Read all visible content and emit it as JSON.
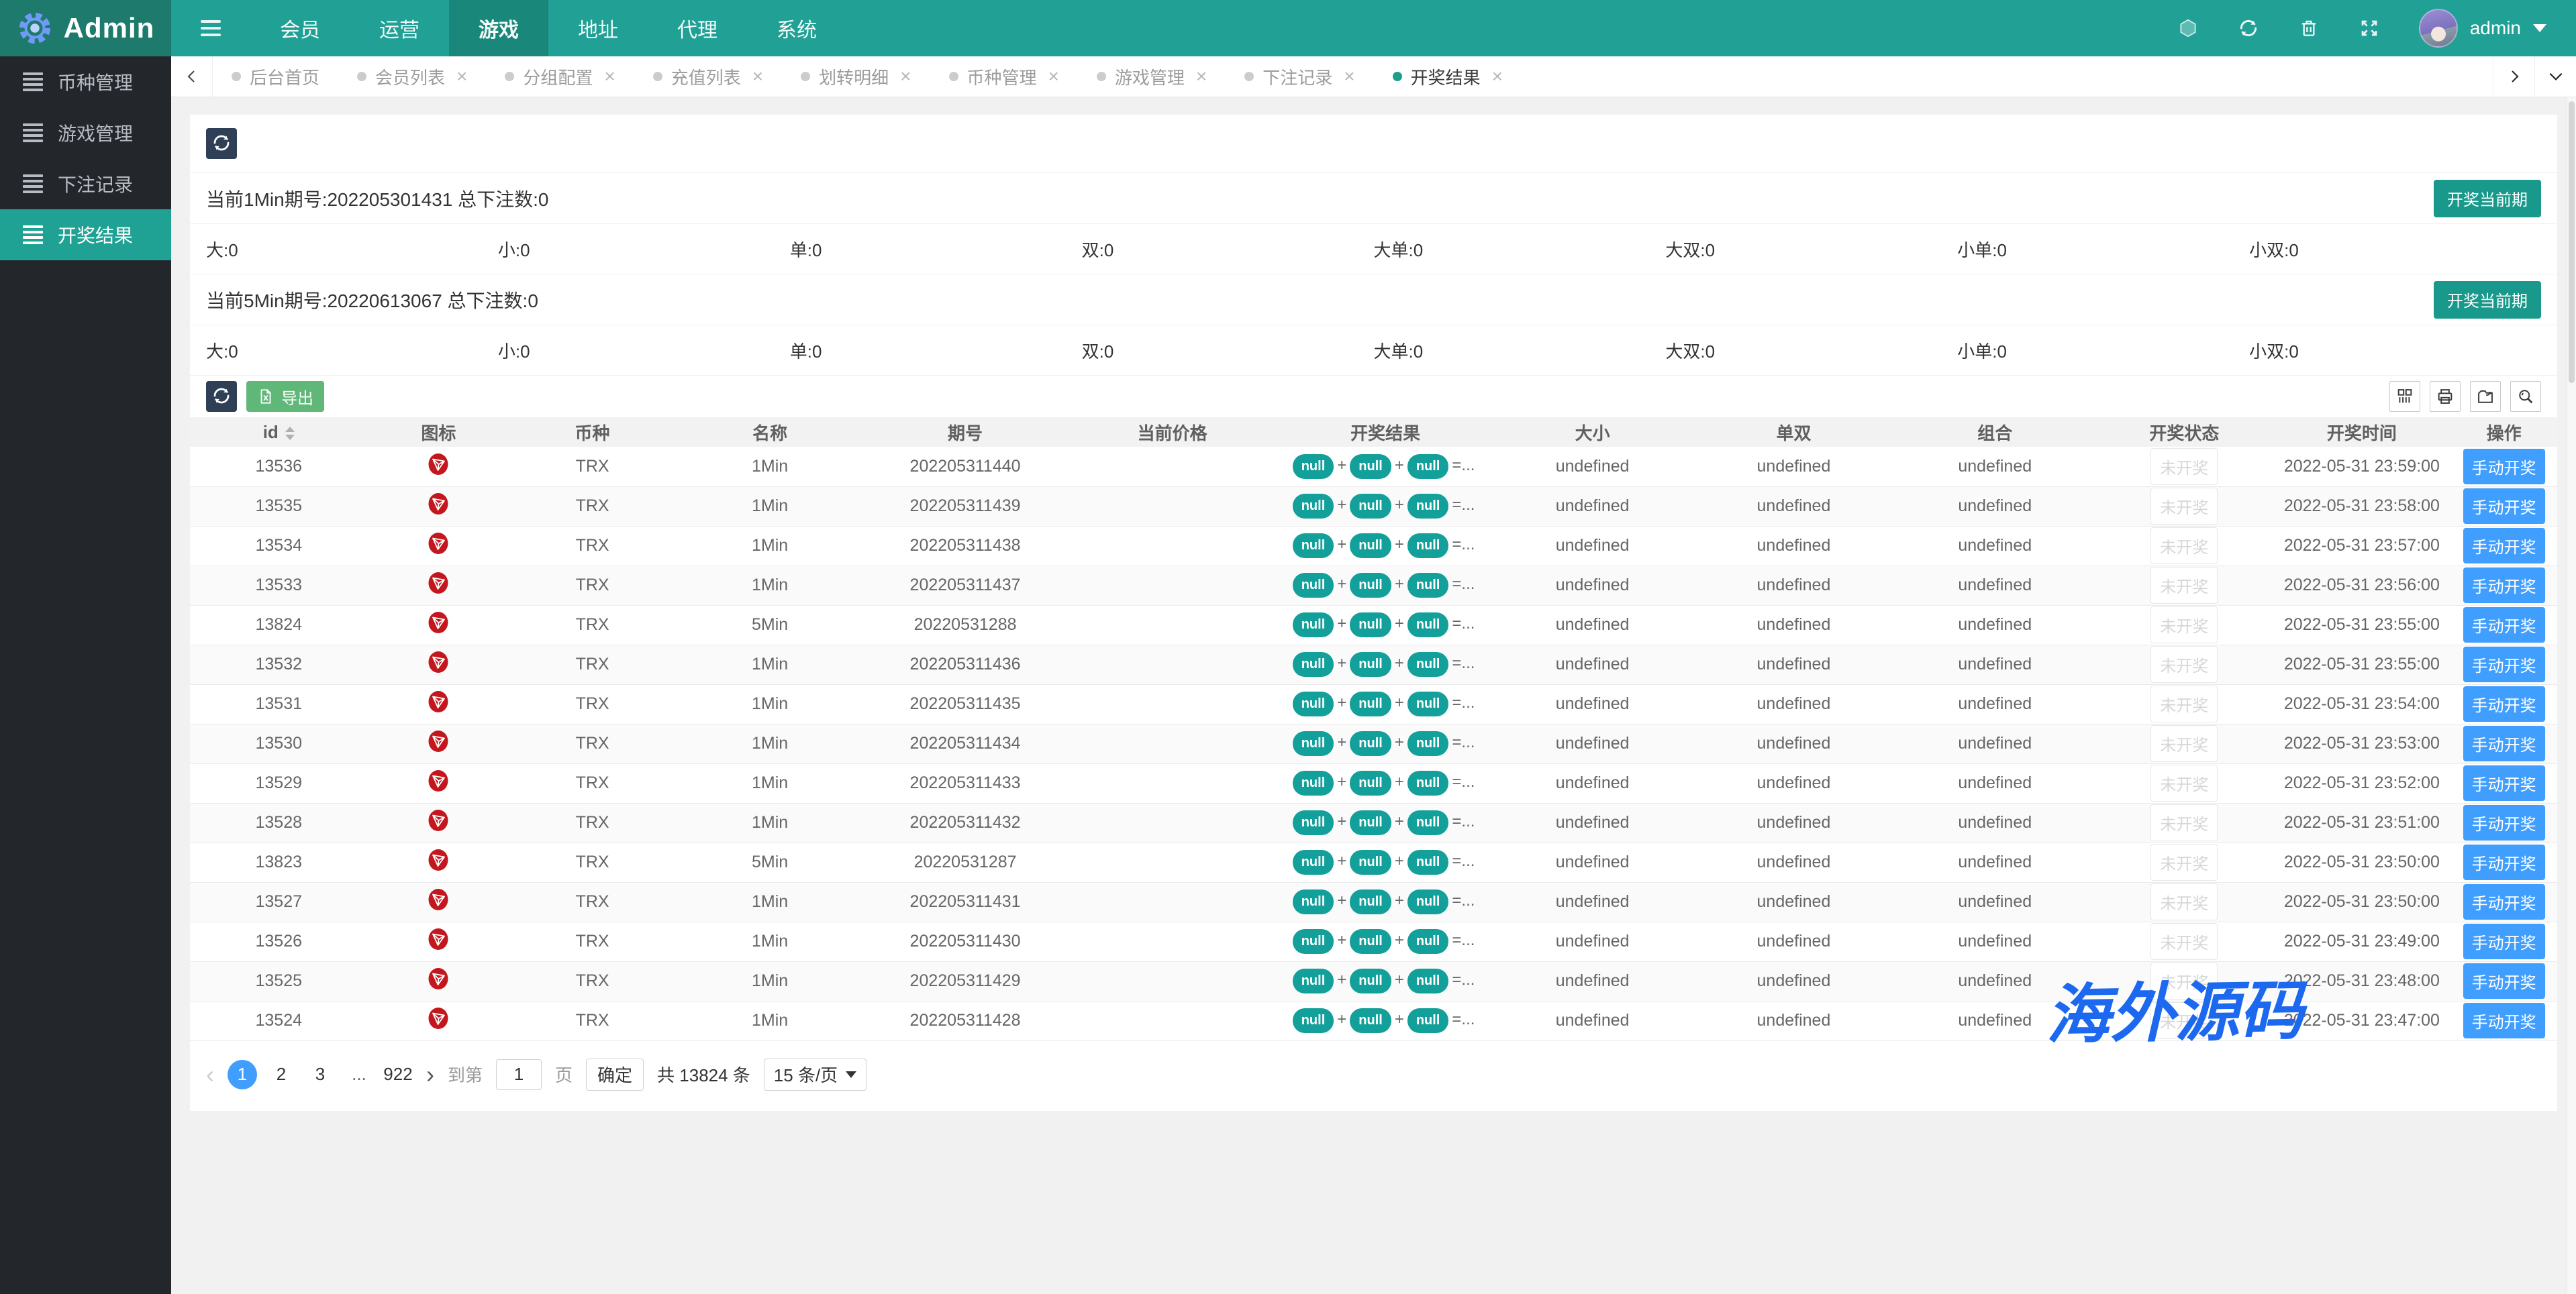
{
  "topbar": {
    "brand": "Admin",
    "nav_items": [
      "会员",
      "运营",
      "游戏",
      "地址",
      "代理",
      "系统"
    ],
    "active_nav": "游戏",
    "user": "admin"
  },
  "sidebar": {
    "items": [
      {
        "label": "币种管理",
        "active": false
      },
      {
        "label": "游戏管理",
        "active": false
      },
      {
        "label": "下注记录",
        "active": false
      },
      {
        "label": "开奖结果",
        "active": true
      }
    ]
  },
  "tabbar": {
    "close_glyph": "×",
    "tabs": [
      {
        "label": "后台首页",
        "closable": false,
        "active": false
      },
      {
        "label": "会员列表",
        "closable": true,
        "active": false
      },
      {
        "label": "分组配置",
        "closable": true,
        "active": false
      },
      {
        "label": "充值列表",
        "closable": true,
        "active": false
      },
      {
        "label": "划转明细",
        "closable": true,
        "active": false
      },
      {
        "label": "币种管理",
        "closable": true,
        "active": false
      },
      {
        "label": "游戏管理",
        "closable": true,
        "active": false
      },
      {
        "label": "下注记录",
        "closable": true,
        "active": false
      },
      {
        "label": "开奖结果",
        "closable": true,
        "active": true
      }
    ]
  },
  "lottery_panels": [
    {
      "title": "当前1Min期号:202205301431 总下注数:0",
      "action_label": "开奖当前期",
      "stats": [
        {
          "label": "大",
          "value": "0"
        },
        {
          "label": "小",
          "value": "0"
        },
        {
          "label": "单",
          "value": "0"
        },
        {
          "label": "双",
          "value": "0"
        },
        {
          "label": "大单",
          "value": "0"
        },
        {
          "label": "大双",
          "value": "0"
        },
        {
          "label": "小单",
          "value": "0"
        },
        {
          "label": "小双",
          "value": "0"
        }
      ]
    },
    {
      "title": "当前5Min期号:20220613067 总下注数:0",
      "action_label": "开奖当前期",
      "stats": [
        {
          "label": "大",
          "value": "0"
        },
        {
          "label": "小",
          "value": "0"
        },
        {
          "label": "单",
          "value": "0"
        },
        {
          "label": "双",
          "value": "0"
        },
        {
          "label": "大单",
          "value": "0"
        },
        {
          "label": "大双",
          "value": "0"
        },
        {
          "label": "小单",
          "value": "0"
        },
        {
          "label": "小双",
          "value": "0"
        }
      ]
    }
  ],
  "table": {
    "export_label": "导出",
    "columns": [
      {
        "key": "id",
        "label": "id",
        "sortable": true
      },
      {
        "key": "icon",
        "label": "图标"
      },
      {
        "key": "coin",
        "label": "币种"
      },
      {
        "key": "name",
        "label": "名称"
      },
      {
        "key": "issue",
        "label": "期号"
      },
      {
        "key": "price",
        "label": "当前价格"
      },
      {
        "key": "result",
        "label": "开奖结果"
      },
      {
        "key": "size",
        "label": "大小"
      },
      {
        "key": "parity",
        "label": "单双"
      },
      {
        "key": "combo",
        "label": "组合"
      },
      {
        "key": "status",
        "label": "开奖状态"
      },
      {
        "key": "time",
        "label": "开奖时间"
      },
      {
        "key": "action",
        "label": "操作"
      }
    ],
    "result_badges": [
      "null",
      "null",
      "null"
    ],
    "result_joiner": "+",
    "result_suffix": "=...",
    "rows": [
      {
        "id": "13536",
        "coin": "TRX",
        "name": "1Min",
        "issue": "202205311440",
        "price": "",
        "size": "undefined",
        "parity": "undefined",
        "combo": "undefined",
        "status": "未开奖",
        "time": "2022-05-31 23:59:00",
        "action": "手动开奖"
      },
      {
        "id": "13535",
        "coin": "TRX",
        "name": "1Min",
        "issue": "202205311439",
        "price": "",
        "size": "undefined",
        "parity": "undefined",
        "combo": "undefined",
        "status": "未开奖",
        "time": "2022-05-31 23:58:00",
        "action": "手动开奖"
      },
      {
        "id": "13534",
        "coin": "TRX",
        "name": "1Min",
        "issue": "202205311438",
        "price": "",
        "size": "undefined",
        "parity": "undefined",
        "combo": "undefined",
        "status": "未开奖",
        "time": "2022-05-31 23:57:00",
        "action": "手动开奖"
      },
      {
        "id": "13533",
        "coin": "TRX",
        "name": "1Min",
        "issue": "202205311437",
        "price": "",
        "size": "undefined",
        "parity": "undefined",
        "combo": "undefined",
        "status": "未开奖",
        "time": "2022-05-31 23:56:00",
        "action": "手动开奖"
      },
      {
        "id": "13824",
        "coin": "TRX",
        "name": "5Min",
        "issue": "20220531288",
        "price": "",
        "size": "undefined",
        "parity": "undefined",
        "combo": "undefined",
        "status": "未开奖",
        "time": "2022-05-31 23:55:00",
        "action": "手动开奖"
      },
      {
        "id": "13532",
        "coin": "TRX",
        "name": "1Min",
        "issue": "202205311436",
        "price": "",
        "size": "undefined",
        "parity": "undefined",
        "combo": "undefined",
        "status": "未开奖",
        "time": "2022-05-31 23:55:00",
        "action": "手动开奖"
      },
      {
        "id": "13531",
        "coin": "TRX",
        "name": "1Min",
        "issue": "202205311435",
        "price": "",
        "size": "undefined",
        "parity": "undefined",
        "combo": "undefined",
        "status": "未开奖",
        "time": "2022-05-31 23:54:00",
        "action": "手动开奖"
      },
      {
        "id": "13530",
        "coin": "TRX",
        "name": "1Min",
        "issue": "202205311434",
        "price": "",
        "size": "undefined",
        "parity": "undefined",
        "combo": "undefined",
        "status": "未开奖",
        "time": "2022-05-31 23:53:00",
        "action": "手动开奖"
      },
      {
        "id": "13529",
        "coin": "TRX",
        "name": "1Min",
        "issue": "202205311433",
        "price": "",
        "size": "undefined",
        "parity": "undefined",
        "combo": "undefined",
        "status": "未开奖",
        "time": "2022-05-31 23:52:00",
        "action": "手动开奖"
      },
      {
        "id": "13528",
        "coin": "TRX",
        "name": "1Min",
        "issue": "202205311432",
        "price": "",
        "size": "undefined",
        "parity": "undefined",
        "combo": "undefined",
        "status": "未开奖",
        "time": "2022-05-31 23:51:00",
        "action": "手动开奖"
      },
      {
        "id": "13823",
        "coin": "TRX",
        "name": "5Min",
        "issue": "20220531287",
        "price": "",
        "size": "undefined",
        "parity": "undefined",
        "combo": "undefined",
        "status": "未开奖",
        "time": "2022-05-31 23:50:00",
        "action": "手动开奖"
      },
      {
        "id": "13527",
        "coin": "TRX",
        "name": "1Min",
        "issue": "202205311431",
        "price": "",
        "size": "undefined",
        "parity": "undefined",
        "combo": "undefined",
        "status": "未开奖",
        "time": "2022-05-31 23:50:00",
        "action": "手动开奖"
      },
      {
        "id": "13526",
        "coin": "TRX",
        "name": "1Min",
        "issue": "202205311430",
        "price": "",
        "size": "undefined",
        "parity": "undefined",
        "combo": "undefined",
        "status": "未开奖",
        "time": "2022-05-31 23:49:00",
        "action": "手动开奖"
      },
      {
        "id": "13525",
        "coin": "TRX",
        "name": "1Min",
        "issue": "202205311429",
        "price": "",
        "size": "undefined",
        "parity": "undefined",
        "combo": "undefined",
        "status": "未开奖",
        "time": "2022-05-31 23:48:00",
        "action": "手动开奖"
      },
      {
        "id": "13524",
        "coin": "TRX",
        "name": "1Min",
        "issue": "202205311428",
        "price": "",
        "size": "undefined",
        "parity": "undefined",
        "combo": "undefined",
        "status": "未开奖",
        "time": "2022-05-31 23:47:00",
        "action": "手动开奖"
      }
    ]
  },
  "pagination": {
    "prev_glyph": "‹",
    "next_glyph": "›",
    "pages": [
      "1",
      "2",
      "3",
      "...",
      "922"
    ],
    "active_page": "1",
    "goto_prefix": "到第",
    "goto_value": "1",
    "goto_suffix": "页",
    "confirm_label": "确定",
    "total_text": "共 13824 条",
    "page_size": "15 条/页"
  },
  "watermark": "海外源码",
  "colors": {
    "topbar_teal": "#21a095",
    "brand_teal": "#1e7a6d",
    "active_nav_teal": "#19887a",
    "sidebar_dark": "#23262b",
    "button_dark": "#2f4056",
    "button_green": "#5fb878",
    "button_teal": "#18998b",
    "badge_teal": "#13a09a",
    "action_blue": "#409eff",
    "trx_red": "#c4161d",
    "watermark_blue": "#1c69f0"
  }
}
